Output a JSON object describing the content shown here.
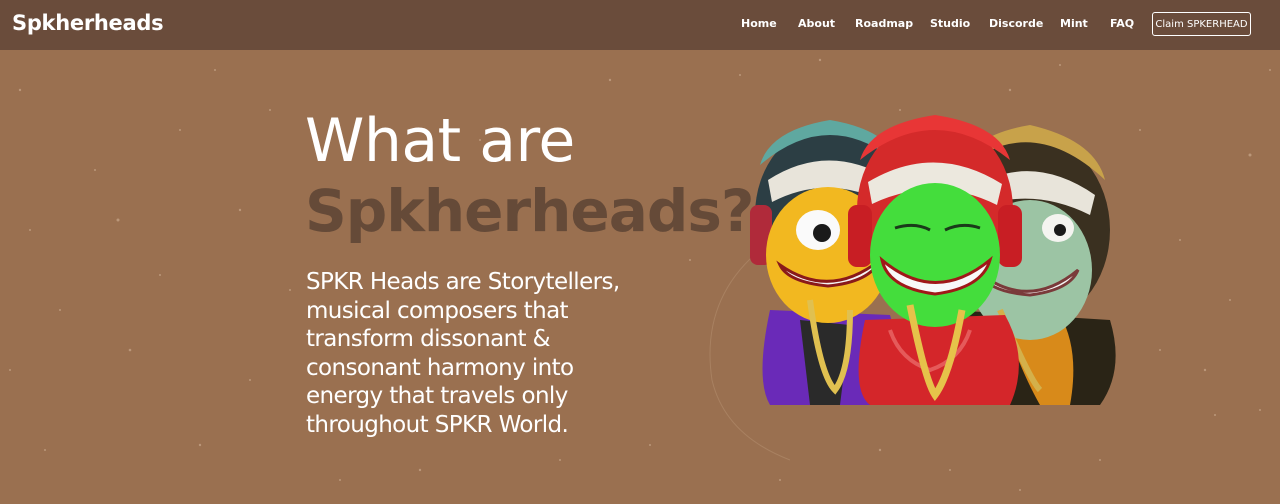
{
  "navbar": {
    "brand": "Spkherheads",
    "links": [
      {
        "label": "Home",
        "id": "home"
      },
      {
        "label": "About",
        "id": "about"
      },
      {
        "label": "Roadmap",
        "id": "roadmap"
      },
      {
        "label": "Studio",
        "id": "studio"
      },
      {
        "label": "Discorde",
        "id": "discorde"
      },
      {
        "label": "Mint",
        "id": "mint"
      },
      {
        "label": "FAQ",
        "id": "faq"
      }
    ],
    "cta_label": "Claim SPKERHEAD"
  },
  "hero": {
    "title_line1": "What are",
    "title_line2": "Spkherheads?",
    "description": "SPKR Heads are Storytellers, musical composers that transform dissonant & consonant harmony into energy that travels only throughout SPKR World."
  },
  "colors": {
    "navbar_bg": "#6a4c3b",
    "page_bg": "#9a7050",
    "title_accent": "#654a38",
    "text": "#ffffff"
  }
}
